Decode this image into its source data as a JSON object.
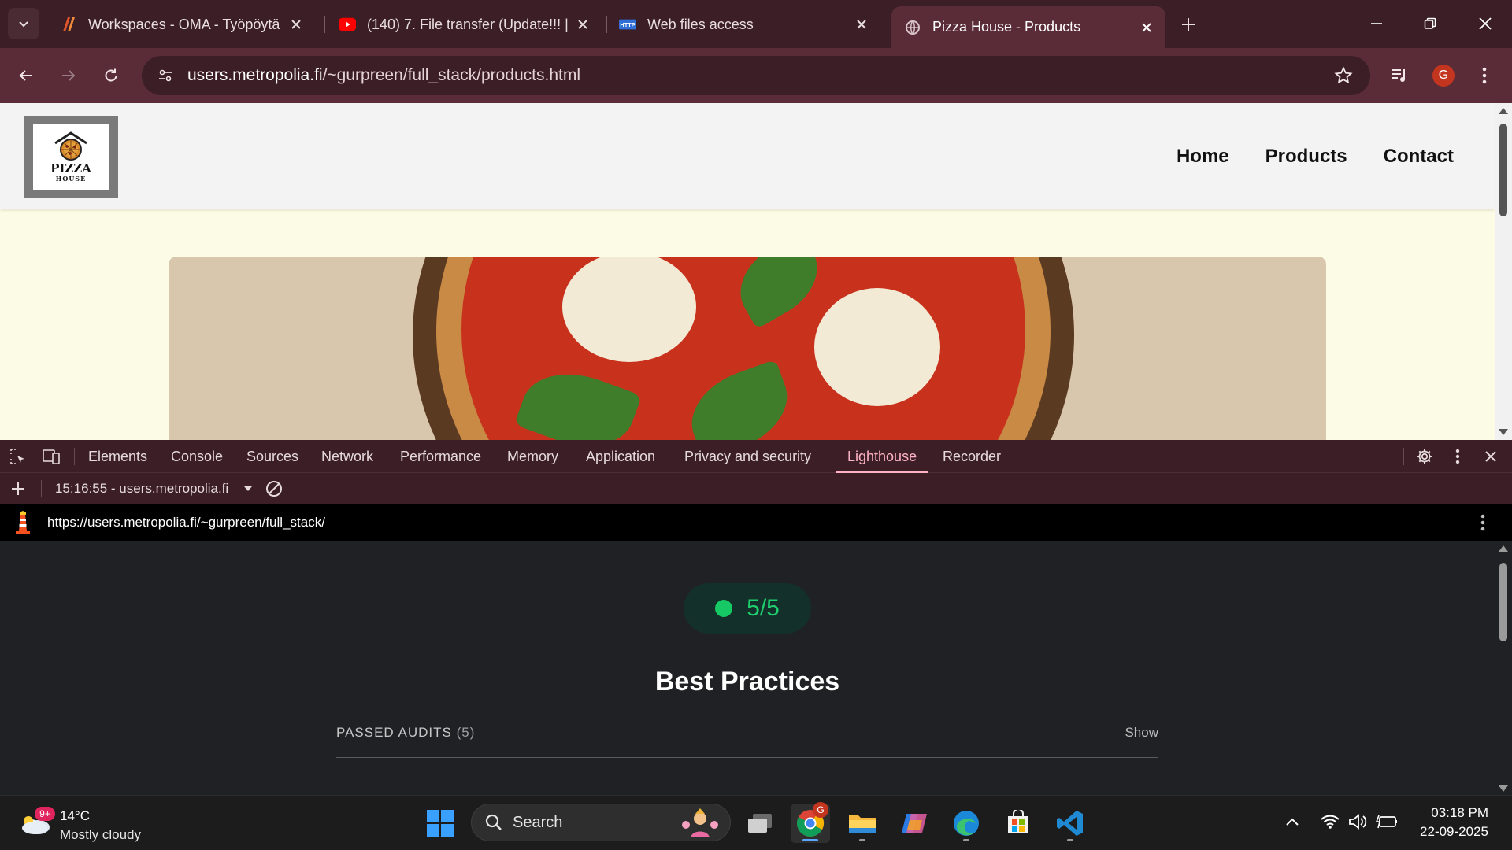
{
  "browser": {
    "tabs": [
      {
        "title": "Workspaces - OMA - Työpöytä",
        "icon": "oma-icon"
      },
      {
        "title": "(140) 7. File transfer (Update!!! |",
        "icon": "youtube-icon"
      },
      {
        "title": "Web files access",
        "icon": "http-icon"
      },
      {
        "title": "Pizza House - Products",
        "icon": "globe-icon",
        "active": true
      }
    ],
    "url_host": "users.metropolia.fi",
    "url_path": "/~gurpreen/full_stack/products.html",
    "profile_initial": "G"
  },
  "site": {
    "logo_line1": "PIZZA",
    "logo_line2": "HOUSE",
    "nav": [
      "Home",
      "Products",
      "Contact"
    ]
  },
  "devtools": {
    "tabs": [
      "Elements",
      "Console",
      "Sources",
      "Network",
      "Performance",
      "Memory",
      "Application",
      "Privacy and security",
      "Lighthouse",
      "Recorder"
    ],
    "active_tab": "Lighthouse",
    "report_label": "15:16:55 - users.metropolia.fi",
    "lighthouse": {
      "report_url": "https://users.metropolia.fi/~gurpreen/full_stack/",
      "score": "5/5",
      "category": "Best Practices",
      "passed_label": "PASSED AUDITS",
      "passed_count": "(5)",
      "show_label": "Show",
      "score_color": "#1fce6e"
    }
  },
  "taskbar": {
    "weather_badge": "9+",
    "temperature": "14°C",
    "weather_desc": "Mostly cloudy",
    "search_label": "Search",
    "chrome_badge": "G",
    "time": "03:18 PM",
    "date": "22-09-2025"
  },
  "colors": {
    "chrome_frame": "#3b1e26",
    "chrome_toolbar": "#5a2c37",
    "devtools_accent": "#ffb3c4",
    "page_bg": "#fbfbe6"
  }
}
